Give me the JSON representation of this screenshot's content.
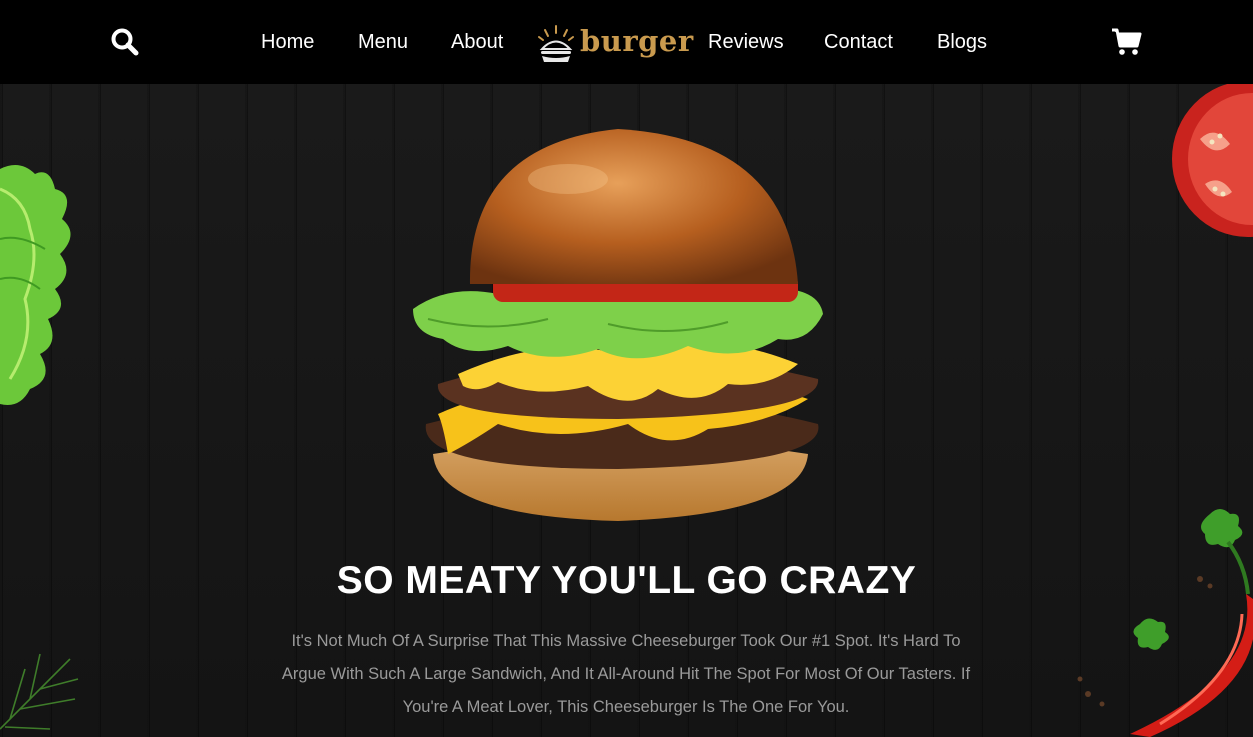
{
  "nav": {
    "links_left": [
      "Home",
      "Menu",
      "About"
    ],
    "links_right": [
      "Reviews",
      "Contact",
      "Blogs"
    ],
    "logo_text": "burger",
    "icons": {
      "search": "search-icon",
      "cart": "cart-icon"
    }
  },
  "hero": {
    "title": "SO MEATY YOU'LL GO CRAZY",
    "description": "It's Not Much Of A Surprise That This Massive Cheeseburger Took Our #1 Spot. It's Hard To Argue With Such A Large Sandwich, And It All-Around Hit The Spot For Most Of Our Tasters. If You're A Meat Lover, This Cheeseburger Is The One For You."
  },
  "colors": {
    "nav_bg": "#000000",
    "logo_gold": "#c99a4e",
    "text_muted": "#9a9a9a",
    "bg_wood": "#141414"
  }
}
